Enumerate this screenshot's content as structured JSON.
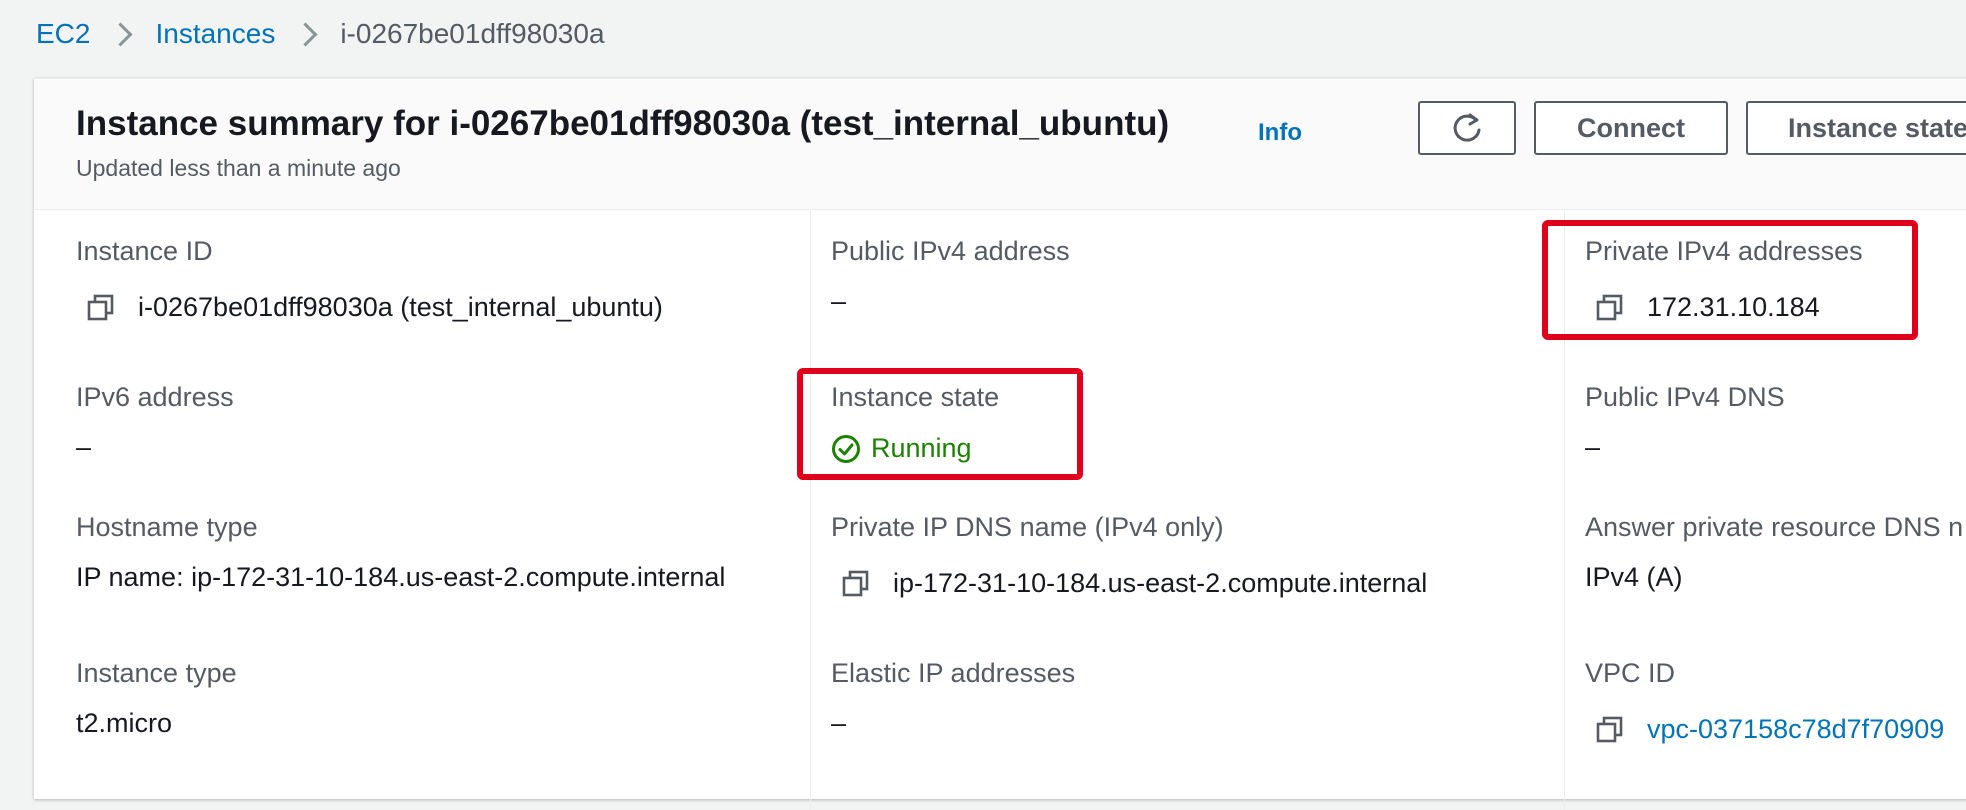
{
  "breadcrumb": {
    "items": [
      "EC2",
      "Instances"
    ],
    "current": "i-0267be01dff98030a"
  },
  "header": {
    "title": "Instance summary for i-0267be01dff98030a (test_internal_ubuntu)",
    "info_label": "Info",
    "subtitle": "Updated less than a minute ago",
    "connect_label": "Connect",
    "instance_state_label": "Instance state"
  },
  "fields": {
    "instance_id": {
      "label": "Instance ID",
      "value": "i-0267be01dff98030a (test_internal_ubuntu)"
    },
    "public_ipv4": {
      "label": "Public IPv4 address",
      "value": "–"
    },
    "private_ipv4": {
      "label": "Private IPv4 addresses",
      "value": "172.31.10.184"
    },
    "ipv6": {
      "label": "IPv6 address",
      "value": "–"
    },
    "instance_state": {
      "label": "Instance state",
      "value": "Running"
    },
    "public_dns": {
      "label": "Public IPv4 DNS",
      "value": "–"
    },
    "hostname_type": {
      "label": "Hostname type",
      "value": "IP name: ip-172-31-10-184.us-east-2.compute.internal"
    },
    "private_dns": {
      "label": "Private IP DNS name (IPv4 only)",
      "value": "ip-172-31-10-184.us-east-2.compute.internal"
    },
    "answer_dns": {
      "label": "Answer private resource DNS n",
      "value": "IPv4 (A)"
    },
    "instance_type": {
      "label": "Instance type",
      "value": "t2.micro"
    },
    "elastic_ip": {
      "label": "Elastic IP addresses",
      "value": "–"
    },
    "vpc_id": {
      "label": "VPC ID",
      "value": "vpc-037158c78d7f70909"
    }
  },
  "colors": {
    "link": "#0073bb",
    "running": "#1d8102",
    "highlight": "#e0001b"
  },
  "icons": {
    "copy": "copy-icon",
    "refresh": "refresh-icon",
    "status": "check-circle-icon"
  }
}
